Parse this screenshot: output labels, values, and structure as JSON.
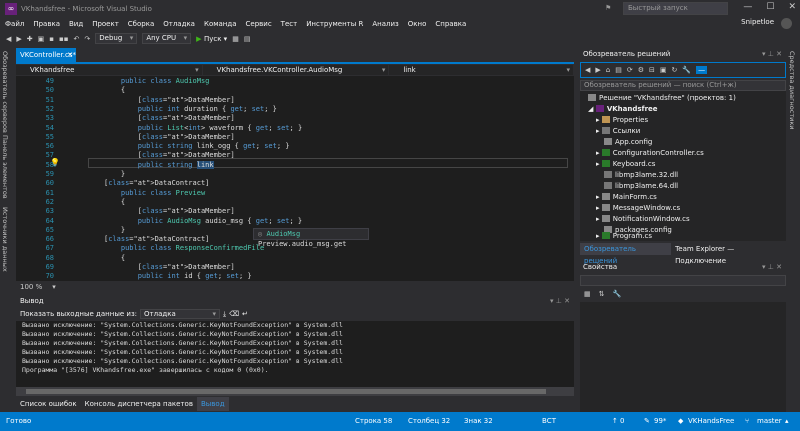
{
  "window": {
    "title": "VKhandsfree - Microsoft Visual Studio",
    "quick_launch_placeholder": "Быстрый запуск",
    "user": "Snipetloe"
  },
  "menu": [
    "Файл",
    "Правка",
    "Вид",
    "Проект",
    "Сборка",
    "Отладка",
    "Команда",
    "Сервис",
    "Тест",
    "Инструменты R",
    "Анализ",
    "Окно",
    "Справка"
  ],
  "toolbar": {
    "config": "Debug",
    "platform": "Any CPU",
    "run_label": "Пуск"
  },
  "left_tabs": [
    "Обозреватель серверов",
    "Панель элементов",
    "Источники данных"
  ],
  "document": {
    "tab_label": "VKController.cs*",
    "nav_project": "VKhandsfree",
    "nav_class": "VKhandsfree.VKController.AudioMsg",
    "nav_member": "link"
  },
  "editor": {
    "lines": [
      {
        "n": "49",
        "t": "    public class AudioMsg"
      },
      {
        "n": "50",
        "t": "    {"
      },
      {
        "n": "51",
        "t": "        [DataMember]"
      },
      {
        "n": "52",
        "t": "        public int duration { get; set; }"
      },
      {
        "n": "53",
        "t": "        [DataMember]"
      },
      {
        "n": "54",
        "t": "        public List<int> waveform { get; set; }"
      },
      {
        "n": "55",
        "t": "        [DataMember]"
      },
      {
        "n": "56",
        "t": "        public string link_ogg { get; set; }"
      },
      {
        "n": "57",
        "t": "        [DataMember]"
      },
      {
        "n": "58",
        "t": "        public string link"
      },
      {
        "n": "59",
        "t": "    }"
      },
      {
        "n": "60",
        "t": "[DataContract]"
      },
      {
        "n": "61",
        "t": "    public class Preview"
      },
      {
        "n": "62",
        "t": "    {"
      },
      {
        "n": "63",
        "t": "        [DataMember]"
      },
      {
        "n": "64",
        "t": "        public AudioMsg audio_msg { get; set; }"
      },
      {
        "n": "65",
        "t": "    }"
      },
      {
        "n": "66",
        "t": "[DataContract]"
      },
      {
        "n": "67",
        "t": "    public class ResponseConfirmedFile"
      },
      {
        "n": "68",
        "t": "    {"
      },
      {
        "n": "69",
        "t": "        [DataMember]"
      },
      {
        "n": "70",
        "t": "        public int id { get; set; }"
      }
    ],
    "tooltip_class": "AudioMsg",
    "tooltip_member": "Preview.audio_msg.get",
    "zoom": "100 %"
  },
  "output": {
    "title": "Вывод",
    "source_label": "Показать выходные данные из:",
    "source_value": "Отладка",
    "lines": [
      "Вызвано исключение: \"System.Collections.Generic.KeyNotFoundException\" в System.dll",
      "Вызвано исключение: \"System.Collections.Generic.KeyNotFoundException\" в System.dll",
      "Вызвано исключение: \"System.Collections.Generic.KeyNotFoundException\" в System.dll",
      "Вызвано исключение: \"System.Collections.Generic.KeyNotFoundException\" в System.dll",
      "Вызвано исключение: \"System.Collections.Generic.KeyNotFoundException\" в System.dll",
      "Программа \"[3576] VKhandsfree.exe\" завершилась с кодом 0 (0x0)."
    ]
  },
  "bottom_tabs": [
    "Список ошибок",
    "Консоль диспетчера пакетов",
    "Вывод"
  ],
  "solution": {
    "title": "Обозреватель решений",
    "search_placeholder": "Обозреватель решений — поиск (Ctrl+ж)",
    "items": [
      {
        "label": "Решение \"VKhandsfree\" (проектов: 1)",
        "icon": "solution-icon"
      },
      {
        "label": "VKhandsfree",
        "icon": "project-icon"
      },
      {
        "label": "Properties",
        "icon": "folder-icon"
      },
      {
        "label": "Ссылки",
        "icon": "references-icon"
      },
      {
        "label": "App.config",
        "icon": "config-icon"
      },
      {
        "label": "ConfigurationController.cs",
        "icon": "csharp-file-icon"
      },
      {
        "label": "Keyboard.cs",
        "icon": "csharp-file-icon"
      },
      {
        "label": "libmp3lame.32.dll",
        "icon": "dll-icon"
      },
      {
        "label": "libmp3lame.64.dll",
        "icon": "dll-icon"
      },
      {
        "label": "MainForm.cs",
        "icon": "form-icon"
      },
      {
        "label": "MessageWindow.cs",
        "icon": "form-icon"
      },
      {
        "label": "NotificationWindow.cs",
        "icon": "form-icon"
      },
      {
        "label": "packages.config",
        "icon": "config-icon"
      },
      {
        "label": "Program.cs",
        "icon": "csharp-file-icon"
      }
    ],
    "tabs": [
      "Обозреватель решений",
      "Team Explorer — Подключение"
    ]
  },
  "properties": {
    "title": "Свойства"
  },
  "right_tabs": [
    "Средства диагностики"
  ],
  "status": {
    "ready": "Готово",
    "line": "Строка 58",
    "col": "Столбец 32",
    "char": "Знак 32",
    "mode": "ВСТ",
    "up": "0",
    "edits": "99*",
    "repo": "VKHandsFree",
    "branch": "master"
  }
}
